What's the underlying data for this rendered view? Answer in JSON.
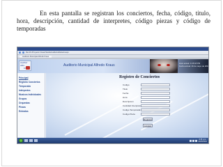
{
  "caption": "En esta pantalla se registran los conciertos, fecha, código, titulo, hora, descripción, cantidad de interpretes, código piezas y código de temporadas",
  "browser": {
    "url": "file:///C:/Proyecto Visual Studio/Auditorio/Default.aspx",
    "tab": "Auditorio Municipal Alfredo Kraus"
  },
  "app": {
    "logo": {
      "line1": "Auditori",
      "line2": "Alfre",
      "line3": "Kraus"
    },
    "title": "Auditorio Municipal Alfredo Kraus",
    "datetime": {
      "line1": "Hora actual: 4:15:18 PM",
      "line2": "Fecha actual: 16 de mayo de 2011"
    }
  },
  "sidebar": {
    "items": [
      {
        "label": "Principal"
      },
      {
        "label": "Registro Conciertos"
      },
      {
        "label": "Temporada"
      },
      {
        "label": "Intérpretes"
      },
      {
        "label": "Musicos Individuales"
      },
      {
        "label": "Grupos"
      },
      {
        "label": "Orquestas"
      },
      {
        "label": "Piezas"
      },
      {
        "label": "Entradas"
      }
    ]
  },
  "form": {
    "title": "Registro de Conciertos",
    "fields": [
      {
        "label": "Codigo",
        "value": ""
      },
      {
        "label": "Titulo",
        "value": ""
      },
      {
        "label": "Fecha",
        "value": ""
      },
      {
        "label": "Hora",
        "value": ""
      },
      {
        "label": "Descripcion",
        "value": ""
      },
      {
        "label": "Cantidad Interpretes",
        "value": ""
      },
      {
        "label": "Codigo Temporada",
        "value": ""
      },
      {
        "label": "Codigo Pieza",
        "value": ""
      }
    ],
    "buttons": {
      "save": "Registrar",
      "clear": "Limpiar"
    }
  },
  "taskbar": {
    "clock_time": "4:15 p.m.",
    "clock_date": "16/05/2011"
  },
  "colors": {
    "header_blue": "#1f3f8a",
    "taskbar": "#1f3b70",
    "accent_red": "#b9150f"
  }
}
